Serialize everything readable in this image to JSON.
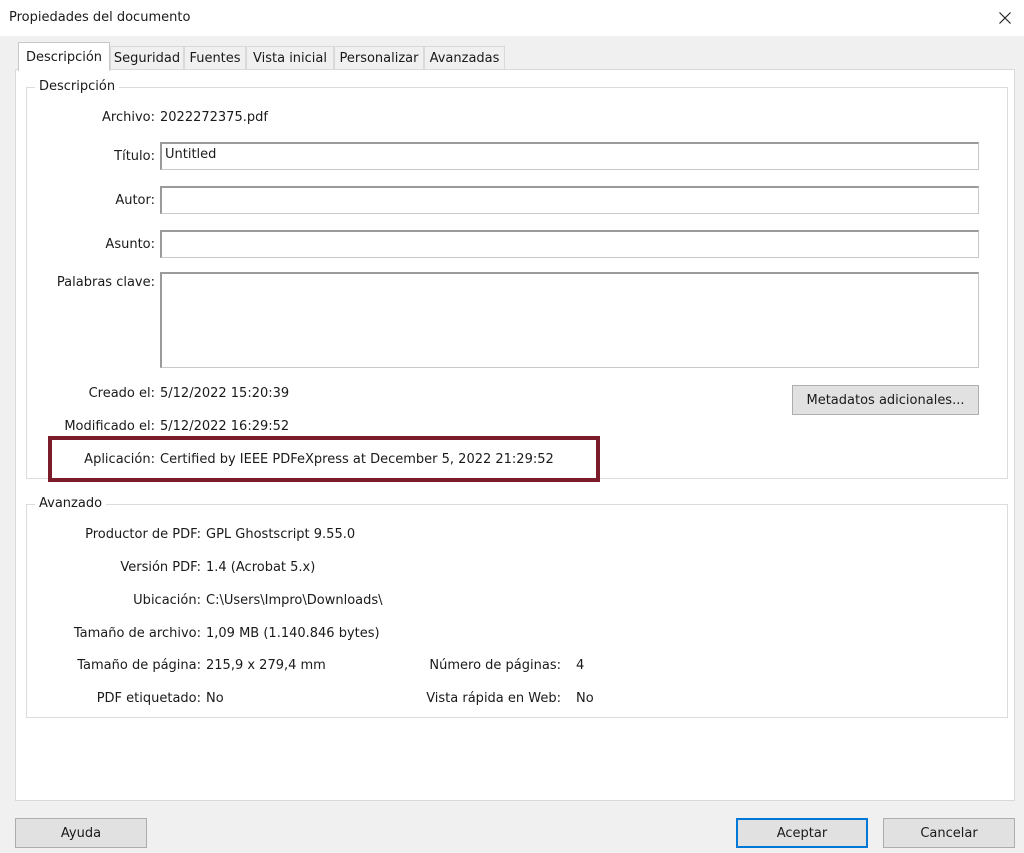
{
  "window": {
    "title": "Propiedades del documento"
  },
  "tabs": [
    {
      "label": "Descripción"
    },
    {
      "label": "Seguridad"
    },
    {
      "label": "Fuentes"
    },
    {
      "label": "Vista inicial"
    },
    {
      "label": "Personalizar"
    },
    {
      "label": "Avanzadas"
    }
  ],
  "active_tab": "Descripción",
  "description": {
    "group_title": "Descripción",
    "file": {
      "label": "Archivo:",
      "value": "2022272375.pdf"
    },
    "title": {
      "label": "Título:",
      "value": "Untitled"
    },
    "author": {
      "label": "Autor:",
      "value": ""
    },
    "subject": {
      "label": "Asunto:",
      "value": ""
    },
    "keywords": {
      "label": "Palabras clave:",
      "value": ""
    },
    "created": {
      "label": "Creado el:",
      "value": "5/12/2022 15:20:39"
    },
    "modified": {
      "label": "Modificado el:",
      "value": "5/12/2022 16:29:52"
    },
    "application": {
      "label": "Aplicación:",
      "value": "Certified by IEEE PDFeXpress at December 5, 2022 21:29:52"
    },
    "metadata_button": "Metadatos adicionales..."
  },
  "advanced": {
    "group_title": "Avanzado",
    "producer": {
      "label": "Productor de PDF:",
      "value": "GPL Ghostscript 9.55.0"
    },
    "pdf_version": {
      "label": "Versión PDF:",
      "value": "1.4 (Acrobat 5.x)"
    },
    "location": {
      "label": "Ubicación:",
      "value": "C:\\Users\\Impro\\Downloads\\"
    },
    "file_size": {
      "label": "Tamaño de archivo:",
      "value": "1,09 MB (1.140.846 bytes)"
    },
    "page_size": {
      "label": "Tamaño de página:",
      "value": "215,9 x 279,4 mm"
    },
    "page_count": {
      "label": "Número de páginas:",
      "value": "4"
    },
    "tagged_pdf": {
      "label": "PDF etiquetado:",
      "value": "No"
    },
    "fast_web_view": {
      "label": "Vista rápida en Web:",
      "value": "No"
    }
  },
  "footer": {
    "help": "Ayuda",
    "accept": "Aceptar",
    "cancel": "Cancelar"
  },
  "highlight_color": "#7b1c2a"
}
